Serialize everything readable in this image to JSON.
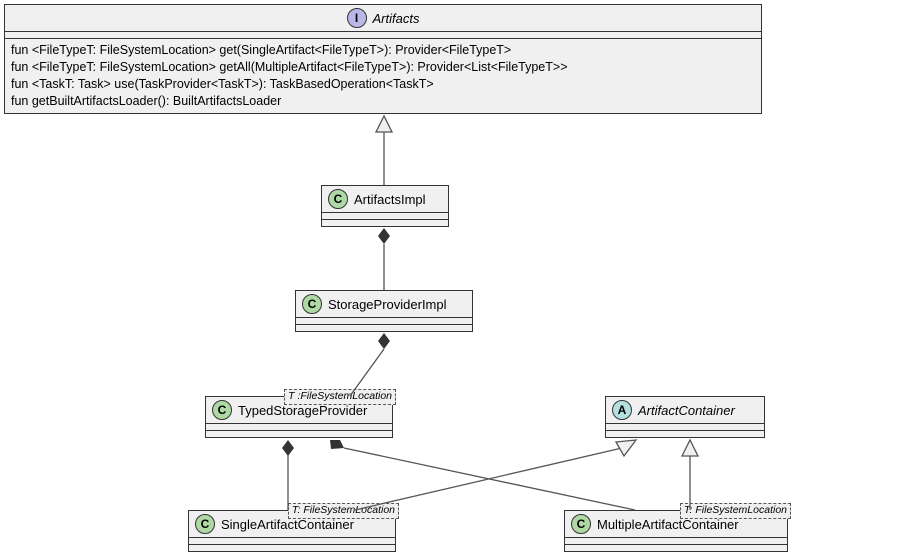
{
  "boxes": {
    "artifacts": {
      "title": "Artifacts",
      "methods": [
        "fun <FileTypeT: FileSystemLocation> get(SingleArtifact<FileTypeT>): Provider<FileTypeT>",
        "fun <FileTypeT: FileSystemLocation> getAll(MultipleArtifact<FileTypeT>): Provider<List<FileTypeT>>",
        "fun <TaskT: Task> use(TaskProvider<TaskT>): TaskBasedOperation<TaskT>",
        "fun getBuiltArtifactsLoader(): BuiltArtifactsLoader"
      ]
    },
    "artifactsImpl": {
      "title": "ArtifactsImpl"
    },
    "storageProviderImpl": {
      "title": "StorageProviderImpl"
    },
    "typedStorageProvider": {
      "title": "TypedStorageProvider",
      "template": "T :FileSystemLocation"
    },
    "artifactContainer": {
      "title": "ArtifactContainer"
    },
    "singleArtifactContainer": {
      "title": "SingleArtifactContainer",
      "template": "T: FileSystemLocation"
    },
    "multipleArtifactContainer": {
      "title": "MultipleArtifactContainer",
      "template": "T: FileSystemLocation"
    }
  },
  "chart_data": {
    "type": "uml-class-diagram",
    "nodes": [
      {
        "id": "Artifacts",
        "kind": "interface"
      },
      {
        "id": "ArtifactsImpl",
        "kind": "class"
      },
      {
        "id": "StorageProviderImpl",
        "kind": "class"
      },
      {
        "id": "TypedStorageProvider",
        "kind": "class",
        "template": "T : FileSystemLocation"
      },
      {
        "id": "ArtifactContainer",
        "kind": "abstract"
      },
      {
        "id": "SingleArtifactContainer",
        "kind": "class",
        "template": "T: FileSystemLocation"
      },
      {
        "id": "MultipleArtifactContainer",
        "kind": "class",
        "template": "T: FileSystemLocation"
      }
    ],
    "edges": [
      {
        "from": "ArtifactsImpl",
        "to": "Artifacts",
        "relation": "realization"
      },
      {
        "from": "ArtifactsImpl",
        "to": "StorageProviderImpl",
        "relation": "composition"
      },
      {
        "from": "StorageProviderImpl",
        "to": "TypedStorageProvider",
        "relation": "composition"
      },
      {
        "from": "TypedStorageProvider",
        "to": "SingleArtifactContainer",
        "relation": "composition"
      },
      {
        "from": "TypedStorageProvider",
        "to": "MultipleArtifactContainer",
        "relation": "composition"
      },
      {
        "from": "SingleArtifactContainer",
        "to": "ArtifactContainer",
        "relation": "generalization"
      },
      {
        "from": "MultipleArtifactContainer",
        "to": "ArtifactContainer",
        "relation": "generalization"
      }
    ]
  }
}
